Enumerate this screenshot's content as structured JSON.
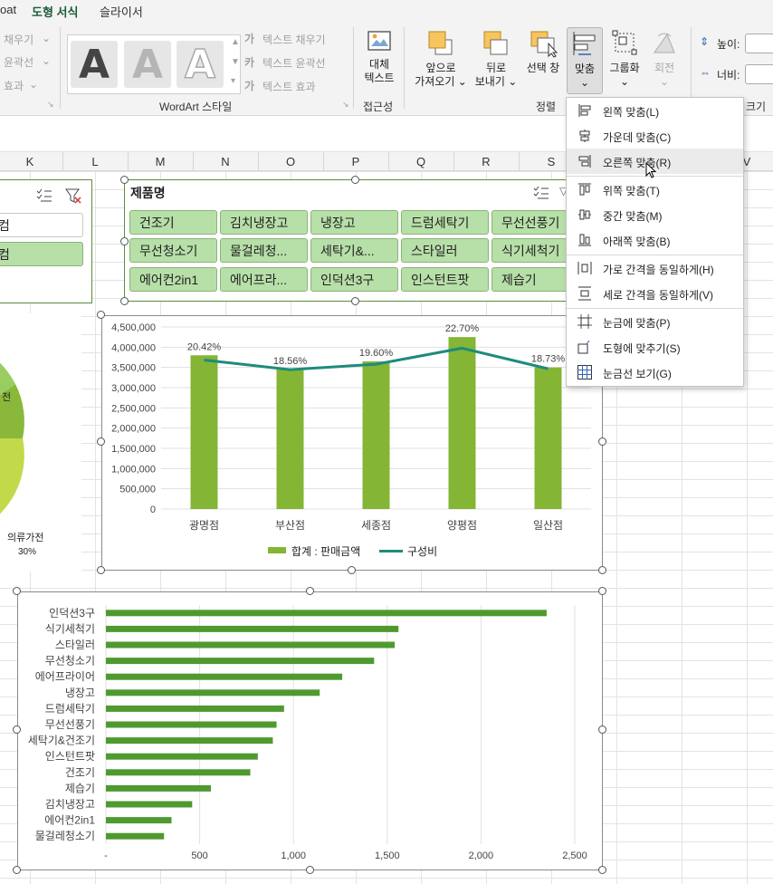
{
  "tabs": [
    "oat",
    "도형 서식",
    "슬라이서"
  ],
  "ribbon": {
    "shape_styles": [
      "채우기",
      "윤곽선",
      "효과"
    ],
    "wordart_text_opts": [
      "텍스트 채우기",
      "텍스트 윤곽선",
      "텍스트 효과"
    ],
    "wordart_glyph": "A",
    "wordart_group": "WordArt 스타일",
    "alt_text": [
      "대체",
      "텍스트"
    ],
    "accessibility_group": "접근성",
    "bring_forward": [
      "앞으로",
      "가져오기"
    ],
    "send_backward": [
      "뒤로",
      "보내기"
    ],
    "selection_pane": "선택 창",
    "align": "맞춤",
    "group": "그룹화",
    "rotate": "회전",
    "arrange_group": "정렬",
    "height_label": "높이:",
    "width_label": "너비:",
    "size_group": "크기"
  },
  "columns": [
    "K",
    "L",
    "M",
    "N",
    "O",
    "P",
    "Q",
    "R",
    "S",
    "V"
  ],
  "slicer_left": {
    "items": [
      "컴",
      "컴"
    ]
  },
  "slicer": {
    "title": "제품명",
    "items": [
      "건조기",
      "김치냉장고",
      "냉장고",
      "드럼세탁기",
      "무선선풍기",
      "무선청소기",
      "물걸레청...",
      "세탁기&...",
      "스타일러",
      "식기세척기",
      "에어컨2in1",
      "에어프라...",
      "인덕션3구",
      "인스턴트팟",
      "제습기"
    ]
  },
  "pie": {
    "label_top": "전",
    "label": "의류가전",
    "percent": "30%"
  },
  "chart_data": [
    {
      "type": "bar",
      "categories": [
        "광명점",
        "부산점",
        "세종점",
        "양평점",
        "일산점"
      ],
      "series": [
        {
          "name": "합계 : 판매금액",
          "values": [
            3800000,
            3450000,
            3650000,
            4250000,
            3500000
          ]
        },
        {
          "name": "구성비",
          "values": [
            0.2042,
            0.1856,
            0.196,
            0.227,
            0.1873
          ]
        }
      ],
      "data_labels": [
        "20.42%",
        "18.56%",
        "19.60%",
        "22.70%",
        "18.73%"
      ],
      "yticks": [
        "4,500,000",
        "4,000,000",
        "3,500,000",
        "3,000,000",
        "2,500,000",
        "2,000,000",
        "1,500,000",
        "1,000,000",
        "500,000",
        "0"
      ],
      "ylim": [
        0,
        4500000
      ],
      "grid": true,
      "legend": "bottom",
      "colors": {
        "bar": "#84b535",
        "line": "#1e8b7c"
      }
    },
    {
      "type": "bar",
      "orientation": "horizontal",
      "categories": [
        "인덕션3구",
        "식기세척기",
        "스타일러",
        "무선청소기",
        "에어프라이어",
        "냉장고",
        "드럼세탁기",
        "무선선풍기",
        "세탁기&건조기",
        "인스턴트팟",
        "건조기",
        "제습기",
        "김치냉장고",
        "에어컨2in1",
        "물걸레청소기"
      ],
      "values": [
        2350,
        1560,
        1540,
        1430,
        1260,
        1140,
        950,
        910,
        890,
        810,
        770,
        560,
        460,
        350,
        310
      ],
      "xticks": [
        "-",
        "500",
        "1,000",
        "1,500",
        "2,000",
        "2,500"
      ],
      "xlim": [
        0,
        2500
      ],
      "grid": true,
      "colors": {
        "bar": "#4f9a2f"
      }
    }
  ],
  "menu": {
    "items": [
      {
        "icon": "align-left-icon",
        "label": "왼쪽 맞춤(L)"
      },
      {
        "icon": "align-center-icon",
        "label": "가운데 맞춤(C)"
      },
      {
        "icon": "align-right-icon",
        "label": "오른쪽 맞춤(R)"
      },
      {
        "icon": "align-top-icon",
        "label": "위쪽 맞춤(T)"
      },
      {
        "icon": "align-middle-icon",
        "label": "중간 맞춤(M)"
      },
      {
        "icon": "align-bottom-icon",
        "label": "아래쪽 맞춤(B)"
      },
      {
        "icon": "distribute-horizontal-icon",
        "label": "가로 간격을 동일하게(H)"
      },
      {
        "icon": "distribute-vertical-icon",
        "label": "세로 간격을 동일하게(V)"
      },
      {
        "icon": "snap-to-grid-icon",
        "label": "눈금에 맞춤(P)"
      },
      {
        "icon": "snap-to-shape-icon",
        "label": "도형에 맞추기(S)"
      },
      {
        "icon": "view-gridlines-icon",
        "label": "눈금선 보기(G)"
      }
    ]
  }
}
